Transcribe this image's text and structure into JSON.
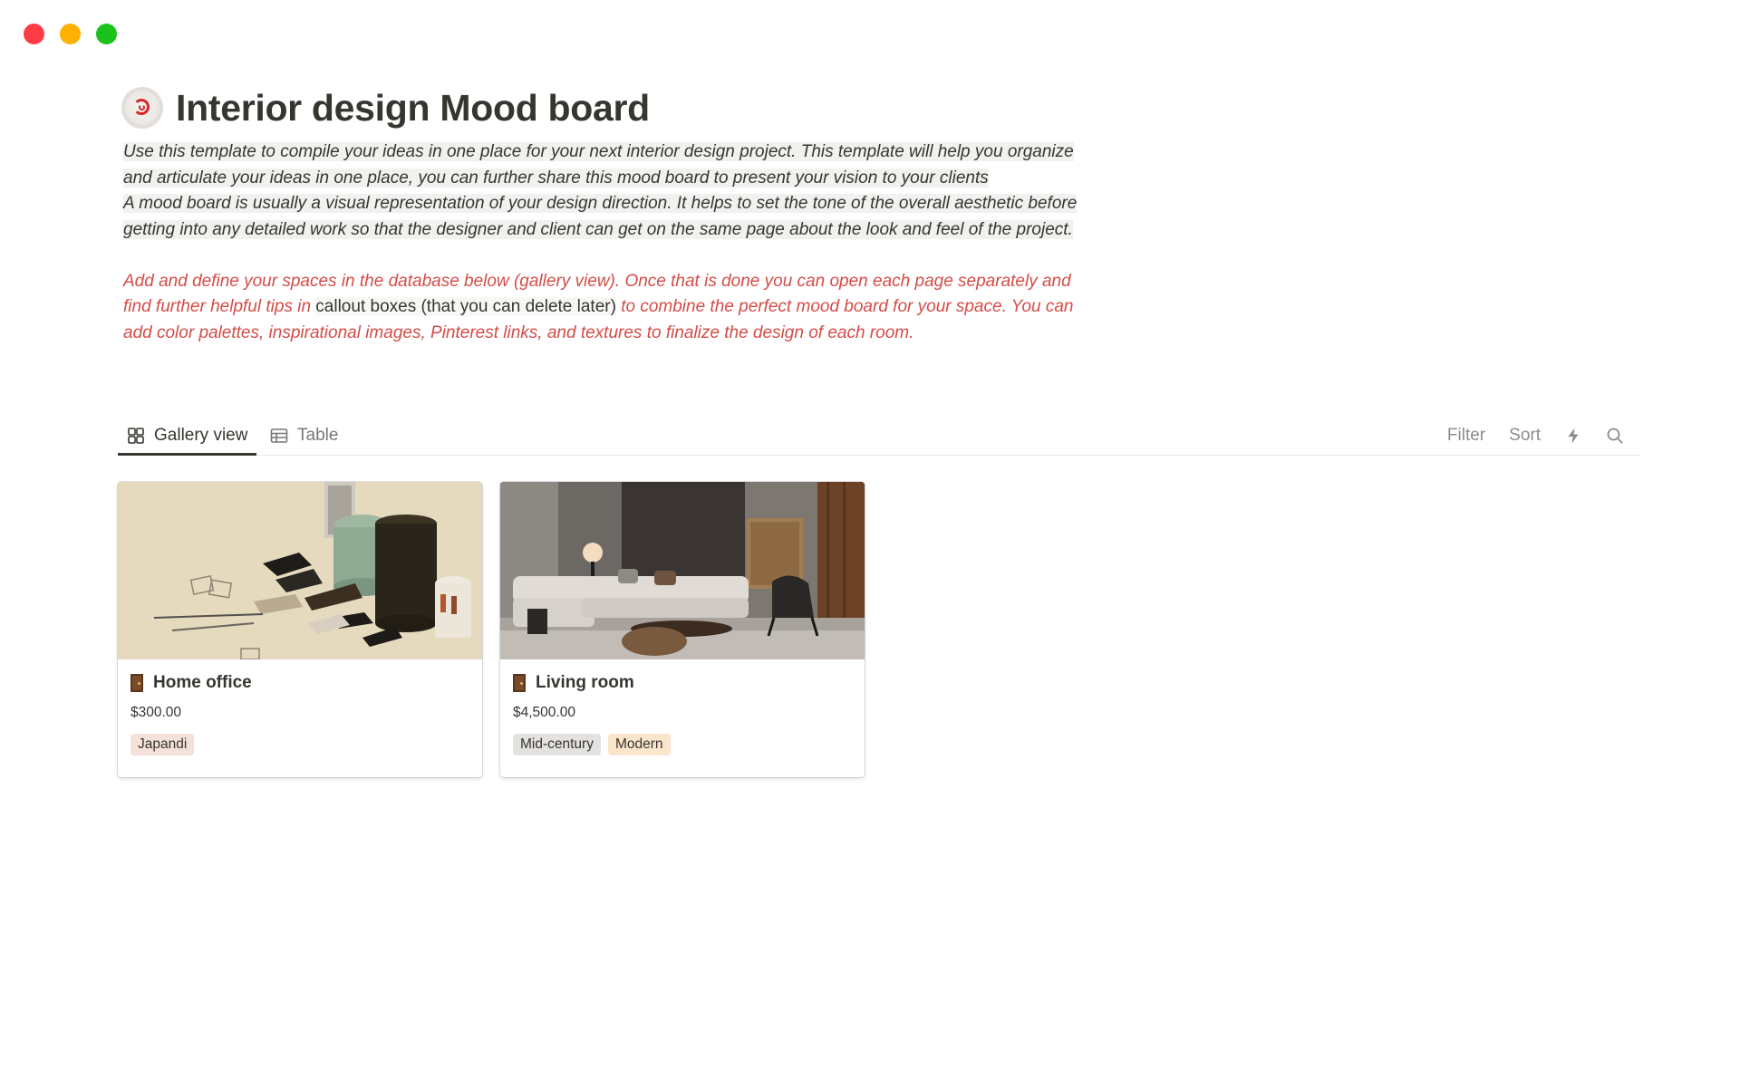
{
  "window": {
    "controls": [
      "close",
      "minimize",
      "maximize"
    ]
  },
  "page": {
    "icon": "spiral-candy-icon",
    "title": "Interior design Mood board",
    "intro_paragraphs": [
      "Use this template to compile your ideas in one place for your next interior design project. This template will help you organize and articulate your ideas in one place, you can further share this mood board to present your vision to your clients",
      "A mood board is usually a visual representation of your design direction. It helps to set the tone of the overall aesthetic before getting into any detailed work so that the designer and client can get on the same page about the look and feel of the project."
    ],
    "tips": {
      "part1": "Add and define your spaces in the database below (gallery view). Once that is done you can open each page separately and find further helpful tips in ",
      "inline_code": "callout boxes (that you can delete later)",
      "part2": " to combine the perfect mood board for your space. You can add color palettes, inspirational images, Pinterest links, and textures to finalize the design of each room."
    }
  },
  "views": {
    "tabs": [
      {
        "label": "Gallery view",
        "icon": "gallery-grid-icon",
        "active": true
      },
      {
        "label": "Table",
        "icon": "table-icon",
        "active": false
      }
    ],
    "actions": {
      "filter": "Filter",
      "sort": "Sort",
      "automation_icon": "lightning-icon",
      "search_icon": "search-icon"
    }
  },
  "cards": [
    {
      "title": "Home office",
      "icon": "door-icon",
      "price": "$300.00",
      "tags": [
        {
          "label": "Japandi",
          "color": "#f4e1d9"
        }
      ]
    },
    {
      "title": "Living room",
      "icon": "door-icon",
      "price": "$4,500.00",
      "tags": [
        {
          "label": "Mid-century",
          "color": "#e3e2e0"
        },
        {
          "label": "Modern",
          "color": "#fbe6cb"
        }
      ]
    }
  ],
  "colors": {
    "text": "#37352f",
    "red_text": "#d44c47",
    "highlight_bg": "#f1f1ef",
    "window_close": "#ff3b46",
    "window_min": "#ffb000",
    "window_max": "#1cc21c"
  }
}
